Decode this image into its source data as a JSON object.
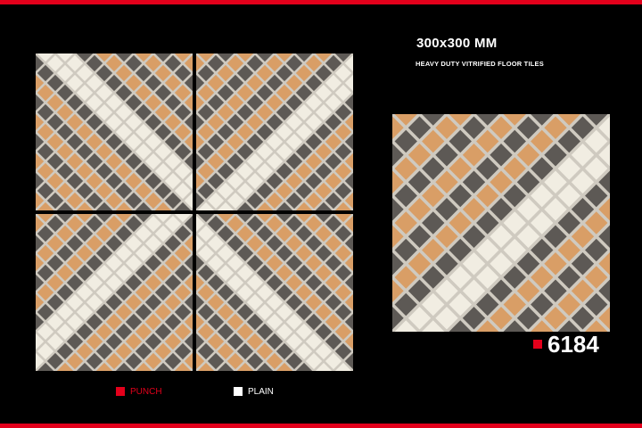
{
  "colors": {
    "accent_red": "#e3001b",
    "tile_white": "#f1ede2",
    "tile_orange": "#d99e66",
    "tile_grey": "#5d5955",
    "grout": "#cfcac0"
  },
  "product": {
    "size": "300x300 MM",
    "subtitle": "HEAVY DUTY VITRIFIED FLOOR TILES",
    "code": "6184"
  },
  "legend": [
    {
      "label": "PUNCH",
      "swatch": "red-square-icon"
    },
    {
      "label": "PLAIN",
      "swatch": "white-square-icon"
    }
  ]
}
